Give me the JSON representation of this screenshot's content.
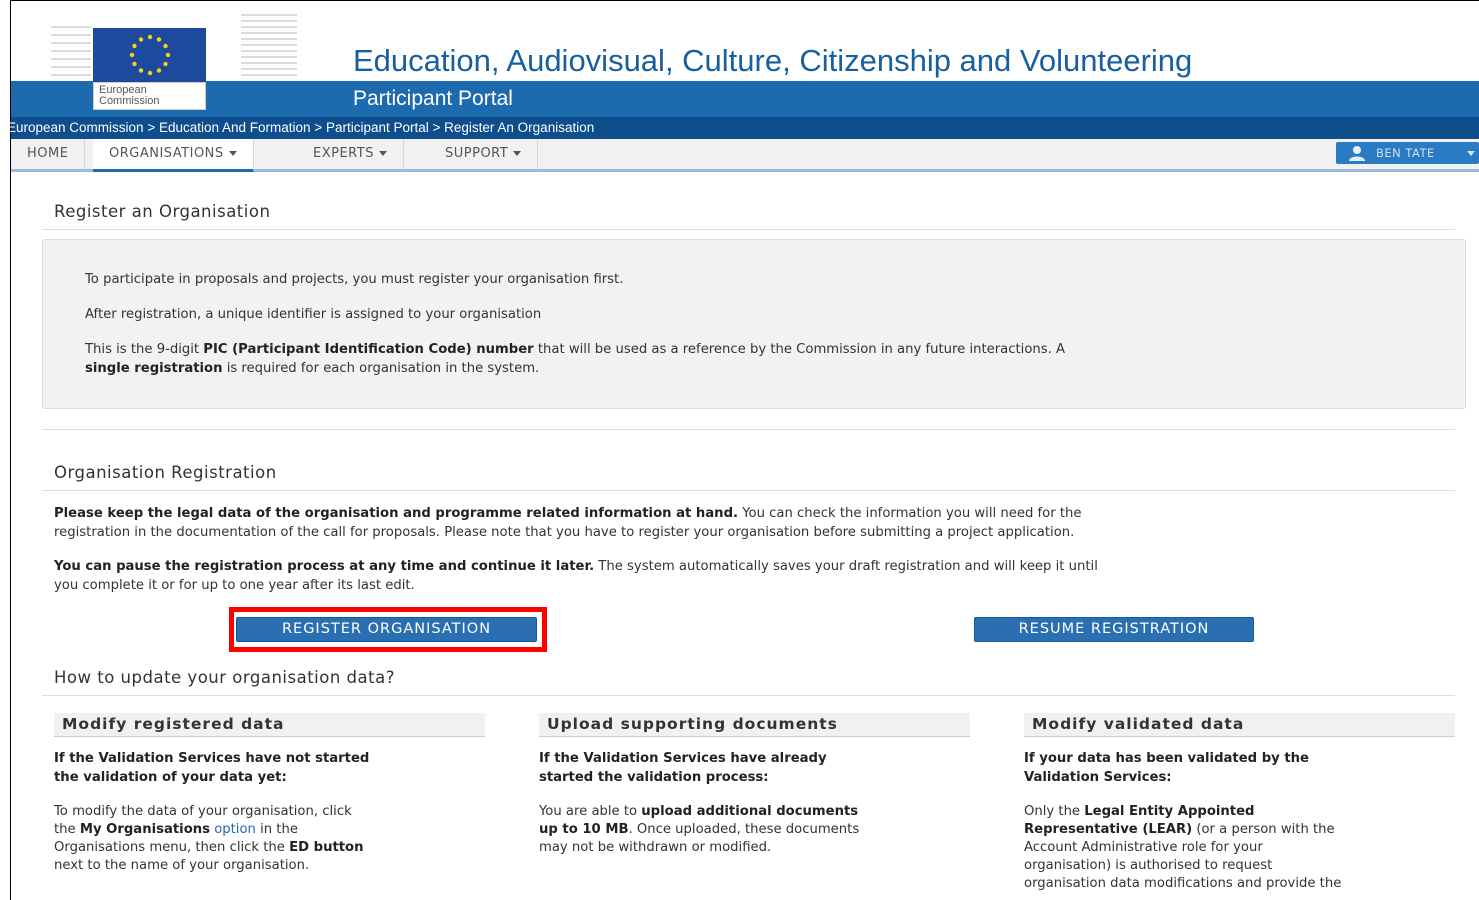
{
  "header": {
    "site_title": "Education, Audiovisual, Culture, Citizenship and Volunteering",
    "portal_title": "Participant Portal",
    "logo_line1": "European",
    "logo_line2": "Commission",
    "breadcrumb": [
      "European Commission",
      "Education And Formation",
      "Participant Portal",
      "Register An Organisation"
    ],
    "breadcrumb_separator": " > "
  },
  "nav": {
    "items": [
      {
        "label": "HOME",
        "has_dropdown": false
      },
      {
        "label": "ORGANISATIONS",
        "has_dropdown": true,
        "active": true
      },
      {
        "label": "EXPERTS",
        "has_dropdown": true
      },
      {
        "label": "SUPPORT",
        "has_dropdown": true
      }
    ],
    "user_label": "BEN TATE"
  },
  "intro": {
    "title": "Register an Organisation",
    "line1": "To participate in proposals and projects, you must register your organisation first.",
    "line2": "After registration, a unique identifier is assigned to your organisation",
    "line3_a": "This is the 9-digit ",
    "line3_b": "PIC (Participant Identification Code) number",
    "line3_c": " that will be used as a reference by the Commission in any future interactions. A",
    "line4_b": "single registration",
    "line4_c": " is required for each organisation in the system."
  },
  "registration": {
    "title": "Organisation Registration",
    "p1_bold": "Please keep the legal data of the organisation and programme related information at hand.",
    "p1_rest": " You can check the information you will need for the",
    "p1_line2": "registration in the documentation of the call for proposals. Please note that you have to register your organisation before submitting a project application.",
    "p2_bold": "You can pause the registration process at any time and continue it later.",
    "p2_rest": " The system automatically saves your draft registration and will keep it until",
    "p2_line2": "you complete it or for up to one year after its last edit.",
    "register_button": "REGISTER ORGANISATION",
    "resume_button": "RESUME REGISTRATION"
  },
  "update": {
    "title": "How to update your organisation data?",
    "col1": {
      "heading": "Modify registered data",
      "sub1": "If the Validation Services have not started",
      "sub2": "the validation of your data yet:",
      "l1": "To modify the data of your organisation, click",
      "l2_a": "the ",
      "l2_link": "My Organisations",
      "l2_opt": " option",
      "l2_c": " in the",
      "l3_a": "Organisations menu, then click the ",
      "l3_b": "ED button",
      "l4": "next to the name of your organisation."
    },
    "col2": {
      "heading": "Upload supporting documents",
      "sub1": "If the Validation Services have already",
      "sub2": "started the validation process:",
      "l1_a": "You are able to ",
      "l1_b": "upload additional documents",
      "l2_b": "up to 10 MB",
      "l2_c": ". Once uploaded, these documents",
      "l3": "may not be withdrawn or modified."
    },
    "col3": {
      "heading": "Modify validated data",
      "sub1": "If your data has been validated by the",
      "sub2": "Validation Services:",
      "l1_a": "Only the ",
      "l1_link": "Legal Entity Appointed",
      "l2_link": "Representative (LEAR)",
      "l2_c": " (or a person with the",
      "l3": "Account Administrative role for your",
      "l4": "organisation) is authorised to request",
      "l5": "organisation data modifications and provide the"
    }
  }
}
